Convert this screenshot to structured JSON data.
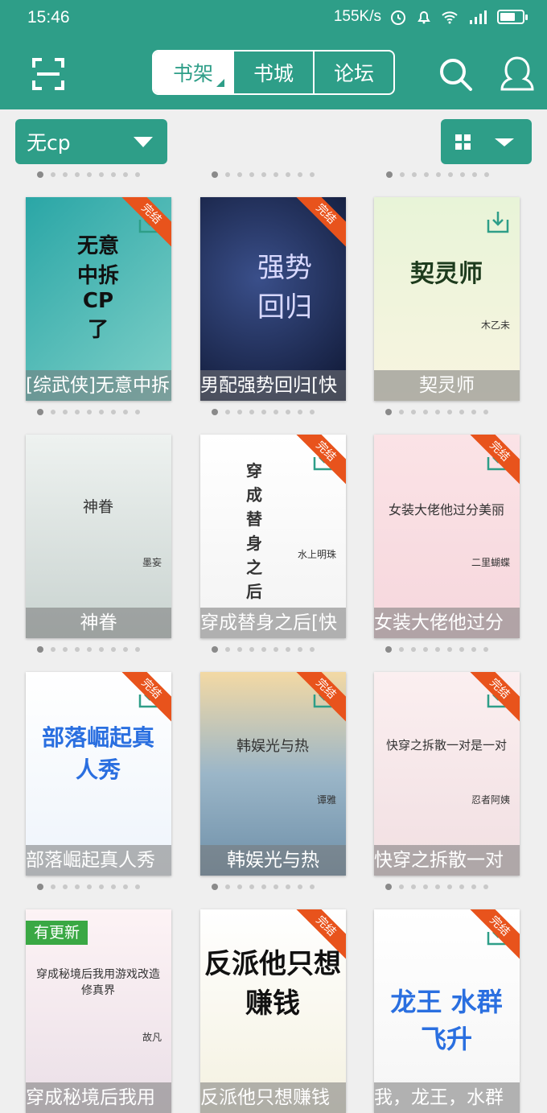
{
  "status": {
    "time": "15:46",
    "speed": "155K/s",
    "battery_level": 0.7
  },
  "tabs": [
    {
      "label": "书架",
      "active": true
    },
    {
      "label": "书城",
      "active": false
    },
    {
      "label": "论坛",
      "active": false
    }
  ],
  "filter": {
    "label": "无cp"
  },
  "colors": {
    "accent": "#2e9e88",
    "ribbon": "#e8531c",
    "update_badge": "#3aa844"
  },
  "books": [
    {
      "title": "[综武侠]无意中拆",
      "completed": true,
      "download": true,
      "cover_text": "无意中拆CP了"
    },
    {
      "title": "男配强势回归[快",
      "completed": true,
      "download": false,
      "cover_text": "强势回归"
    },
    {
      "title": "契灵师",
      "completed": false,
      "download": true,
      "cover_text": "契灵师",
      "cover_author": "木乙未"
    },
    {
      "title": "神眷",
      "completed": false,
      "download": false,
      "cover_text": "神眷",
      "cover_author": "墨妄"
    },
    {
      "title": "穿成替身之后[快",
      "completed": true,
      "download": true,
      "cover_text": "穿成替身之后",
      "cover_author": "水上明珠"
    },
    {
      "title": "女装大佬他过分",
      "completed": true,
      "download": true,
      "cover_text": "女装大佬他过分美丽",
      "cover_author": "二里蝴蝶"
    },
    {
      "title": "部落崛起真人秀",
      "completed": true,
      "download": true,
      "cover_text": "部落崛起真人秀"
    },
    {
      "title": "韩娱光与热",
      "completed": true,
      "download": true,
      "cover_text": "韩娱光与热",
      "cover_author": "谭雅"
    },
    {
      "title": "快穿之拆散一对",
      "completed": true,
      "download": true,
      "cover_text": "快穿之拆散一对是一对",
      "cover_author": "忍者阿姨"
    },
    {
      "title": "穿成秘境后我用",
      "completed": false,
      "download": false,
      "update": "有更新",
      "cover_text": "穿成秘境后我用游戏改造修真界",
      "cover_author": "故凡"
    },
    {
      "title": "反派他只想赚钱",
      "completed": true,
      "download": false,
      "cover_text": "反派他只想赚钱"
    },
    {
      "title": "我，龙王，水群",
      "completed": true,
      "download": true,
      "cover_text": "龙王 水群飞升"
    }
  ],
  "ribbon_label": "完结"
}
